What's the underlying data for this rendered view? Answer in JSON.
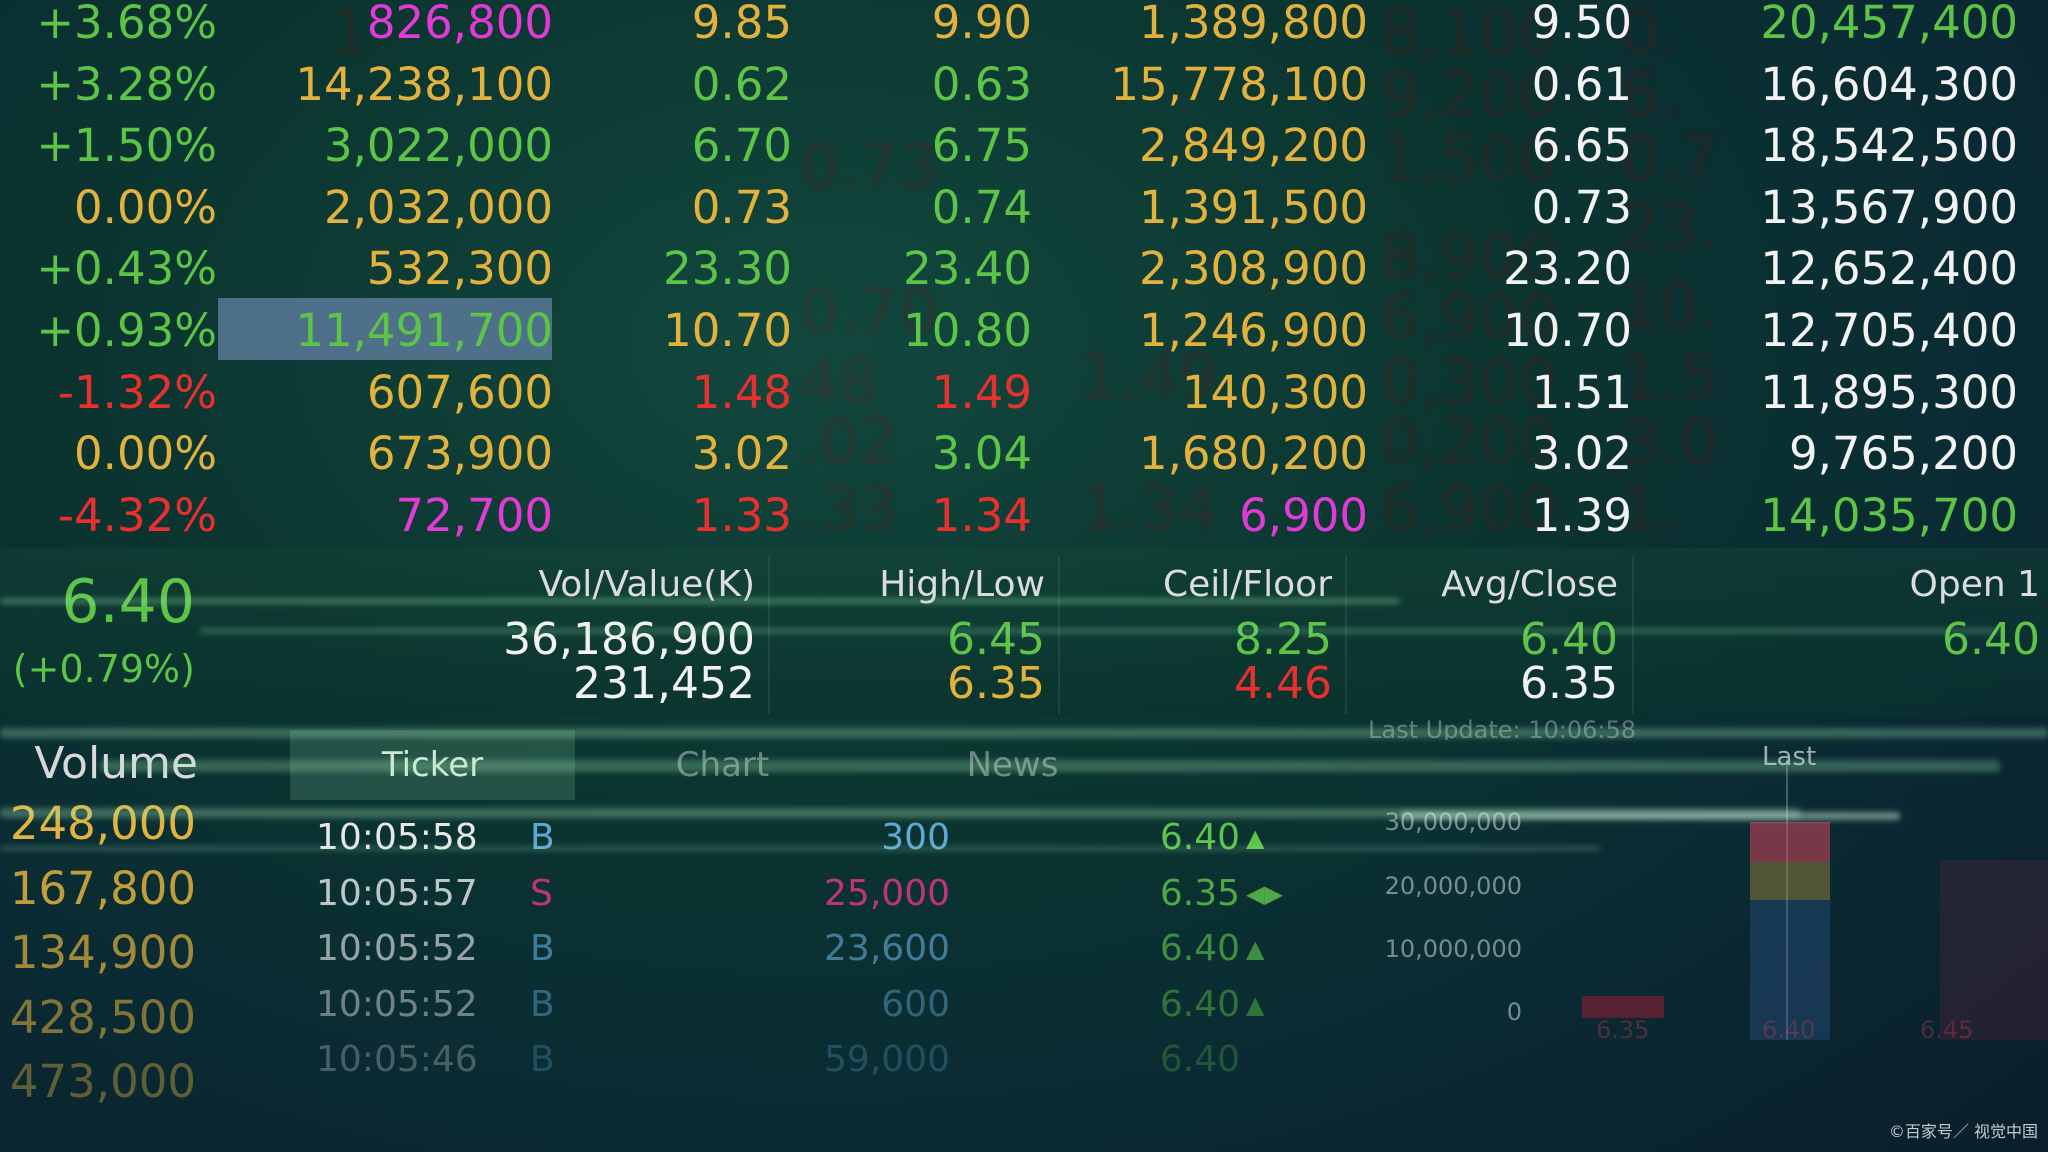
{
  "quote_rows": [
    {
      "change": "+3.68%",
      "volume": "826,800",
      "bid": "9.85",
      "ask": "9.90",
      "bid_vol": "1,389,800",
      "last": "9.50",
      "total": "20,457,400",
      "colors": {
        "change": "#5dc448",
        "volume": "#e23ad6",
        "bid": "#e2b23c",
        "ask": "#e2b23c",
        "bid_vol": "#e2b23c",
        "last": "#f2f2f2",
        "total": "#5dc448"
      }
    },
    {
      "change": "+3.28%",
      "volume": "14,238,100",
      "bid": "0.62",
      "ask": "0.63",
      "bid_vol": "15,778,100",
      "last": "0.61",
      "total": "16,604,300",
      "colors": {
        "change": "#5dc448",
        "volume": "#e2b23c",
        "bid": "#5dc448",
        "ask": "#5dc448",
        "bid_vol": "#e2b23c",
        "last": "#f2f2f2",
        "total": "#f2f2f2"
      }
    },
    {
      "change": "+1.50%",
      "volume": "3,022,000",
      "bid": "6.70",
      "ask": "6.75",
      "bid_vol": "2,849,200",
      "last": "6.65",
      "total": "18,542,500",
      "colors": {
        "change": "#5dc448",
        "volume": "#5dc448",
        "bid": "#5dc448",
        "ask": "#5dc448",
        "bid_vol": "#e2b23c",
        "last": "#f2f2f2",
        "total": "#f2f2f2"
      }
    },
    {
      "change": "0.00%",
      "volume": "2,032,000",
      "bid": "0.73",
      "ask": "0.74",
      "bid_vol": "1,391,500",
      "last": "0.73",
      "total": "13,567,900",
      "colors": {
        "change": "#e2b23c",
        "volume": "#e2b23c",
        "bid": "#e2b23c",
        "ask": "#5dc448",
        "bid_vol": "#e2b23c",
        "last": "#f2f2f2",
        "total": "#f2f2f2"
      }
    },
    {
      "change": "+0.43%",
      "volume": "532,300",
      "bid": "23.30",
      "ask": "23.40",
      "bid_vol": "2,308,900",
      "last": "23.20",
      "total": "12,652,400",
      "colors": {
        "change": "#5dc448",
        "volume": "#e2b23c",
        "bid": "#5dc448",
        "ask": "#5dc448",
        "bid_vol": "#e2b23c",
        "last": "#f2f2f2",
        "total": "#f2f2f2"
      }
    },
    {
      "change": "+0.93%",
      "volume": "11,491,700",
      "bid": "10.70",
      "ask": "10.80",
      "bid_vol": "1,246,900",
      "last": "10.70",
      "total": "12,705,400",
      "colors": {
        "change": "#5dc448",
        "volume": "#5dc448",
        "bid": "#e2b23c",
        "ask": "#5dc448",
        "bid_vol": "#e2b23c",
        "last": "#f2f2f2",
        "total": "#f2f2f2"
      }
    },
    {
      "change": "-1.32%",
      "volume": "607,600",
      "bid": "1.48",
      "ask": "1.49",
      "bid_vol": "140,300",
      "last": "1.51",
      "total": "11,895,300",
      "colors": {
        "change": "#e8302e",
        "volume": "#e2b23c",
        "bid": "#e8302e",
        "ask": "#e8302e",
        "bid_vol": "#e2b23c",
        "last": "#f2f2f2",
        "total": "#f2f2f2"
      }
    },
    {
      "change": "0.00%",
      "volume": "673,900",
      "bid": "3.02",
      "ask": "3.04",
      "bid_vol": "1,680,200",
      "last": "3.02",
      "total": "9,765,200",
      "colors": {
        "change": "#e2b23c",
        "volume": "#e2b23c",
        "bid": "#e2b23c",
        "ask": "#5dc448",
        "bid_vol": "#e2b23c",
        "last": "#f2f2f2",
        "total": "#f2f2f2"
      }
    },
    {
      "change": "-4.32%",
      "volume": "72,700",
      "bid": "1.33",
      "ask": "1.34",
      "bid_vol": "6,900",
      "last": "1.39",
      "total": "14,035,700",
      "colors": {
        "change": "#e8302e",
        "volume": "#e23ad6",
        "bid": "#e8302e",
        "ask": "#e8302e",
        "bid_vol": "#e23ad6",
        "last": "#f2f2f2",
        "total": "#5dc448"
      }
    }
  ],
  "summary": {
    "price": "6.40",
    "change": "5 (+0.79%)",
    "vol_value_label": "Vol/Value(K)",
    "vol_value_1": "36,186,900",
    "vol_value_2": "231,452",
    "high_low_label": "High/Low",
    "high": "6.45",
    "low": "6.35",
    "ceil_floor_label": "Ceil/Floor",
    "ceil": "8.25",
    "floor": "4.46",
    "avg_close_label": "Avg/Close",
    "avg": "6.40",
    "close": "6.35",
    "open_label": "Open 1",
    "open": "6.40"
  },
  "tabs": {
    "ticker": "Ticker",
    "chart": "Chart",
    "news": "News",
    "volume_header": "Volume"
  },
  "left_volumes": [
    "248,000",
    "167,800",
    "134,900",
    "428,500",
    "473,000"
  ],
  "trades": [
    {
      "time": "10:05:58",
      "side": "B",
      "qty": "300",
      "price": "6.40",
      "dir": "▲"
    },
    {
      "time": "10:05:57",
      "side": "S",
      "qty": "25,000",
      "price": "6.35",
      "dir": "◀▶"
    },
    {
      "time": "10:05:52",
      "side": "B",
      "qty": "23,600",
      "price": "6.40",
      "dir": "▲"
    },
    {
      "time": "10:05:52",
      "side": "B",
      "qty": "600",
      "price": "6.40",
      "dir": "▲"
    },
    {
      "time": "10:05:46",
      "side": "B",
      "qty": "59,000",
      "price": "6.40",
      "dir": ""
    }
  ],
  "mini_chart": {
    "last_update": "Last Update: 10:06:58",
    "last_label": "Last",
    "y_ticks": [
      "30,000,000",
      "20,000,000",
      "10,000,000",
      "0"
    ],
    "x_labels": [
      "6.35",
      "6.40",
      "6.45"
    ]
  },
  "credit": "©百家号／ 视觉中国"
}
